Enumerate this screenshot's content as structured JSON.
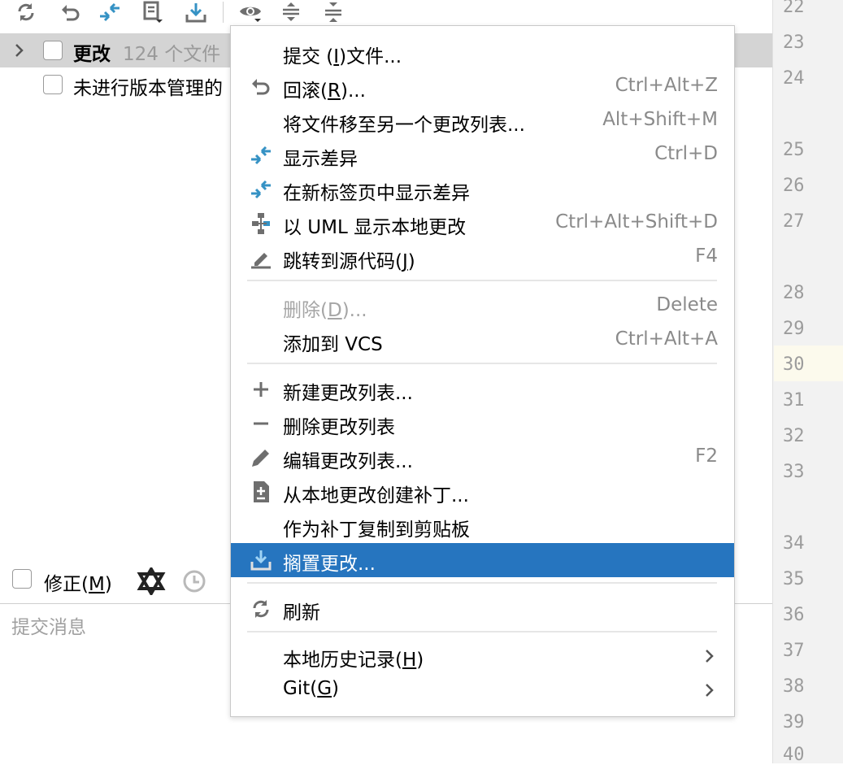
{
  "tree": {
    "changes_label": "更改",
    "changes_count": "124 个文件",
    "unversioned_label": "未进行版本管理的"
  },
  "amend": {
    "label_prefix": "修正(",
    "mnemonic": "M",
    "label_suffix": ")"
  },
  "commit": {
    "placeholder": "提交消息"
  },
  "gutter": {
    "line_numbers": [
      "22",
      "23",
      "24",
      "25",
      "26",
      "27",
      "28",
      "29",
      "30",
      "31",
      "32",
      "33",
      "34",
      "35",
      "36",
      "37",
      "38",
      "39",
      "40"
    ],
    "current_line": "30"
  },
  "menu": {
    "commit": {
      "prefix": "提交 (",
      "mn": "I",
      "suffix": ")文件..."
    },
    "rollback": {
      "prefix": "回滚(",
      "mn": "R",
      "suffix": ")...",
      "shortcut": "Ctrl+Alt+Z"
    },
    "move": {
      "label": "将文件移至另一个更改列表...",
      "shortcut": "Alt+Shift+M"
    },
    "show_diff": {
      "label": "显示差异",
      "shortcut": "Ctrl+D"
    },
    "diff_new_tab": {
      "label": "在新标签页中显示差异"
    },
    "uml": {
      "label": "以 UML 显示本地更改",
      "shortcut": "Ctrl+Alt+Shift+D"
    },
    "jump_source": {
      "prefix": "跳转到源代码(",
      "mn": "J",
      "suffix": ")",
      "shortcut": "F4"
    },
    "delete": {
      "prefix": "删除(",
      "mn": "D",
      "suffix": ")...",
      "shortcut": "Delete"
    },
    "add_vcs": {
      "label": "添加到 VCS",
      "shortcut": "Ctrl+Alt+A"
    },
    "new_list": {
      "label": "新建更改列表..."
    },
    "delete_list": {
      "label": "删除更改列表"
    },
    "edit_list": {
      "label": "编辑更改列表...",
      "shortcut": "F2"
    },
    "create_patch": {
      "label": "从本地更改创建补丁..."
    },
    "copy_patch": {
      "label": "作为补丁复制到剪贴板"
    },
    "shelve": {
      "label": "搁置更改..."
    },
    "refresh": {
      "label": "刷新"
    },
    "local_history": {
      "prefix": "本地历史记录(",
      "mn": "H",
      "suffix": ")"
    },
    "git": {
      "prefix": "Git(",
      "mn": "G",
      "suffix": ")"
    }
  },
  "colors": {
    "accent": "#2675bf",
    "diff_blue": "#3592c4",
    "icon_grey": "#6e6e6e"
  }
}
